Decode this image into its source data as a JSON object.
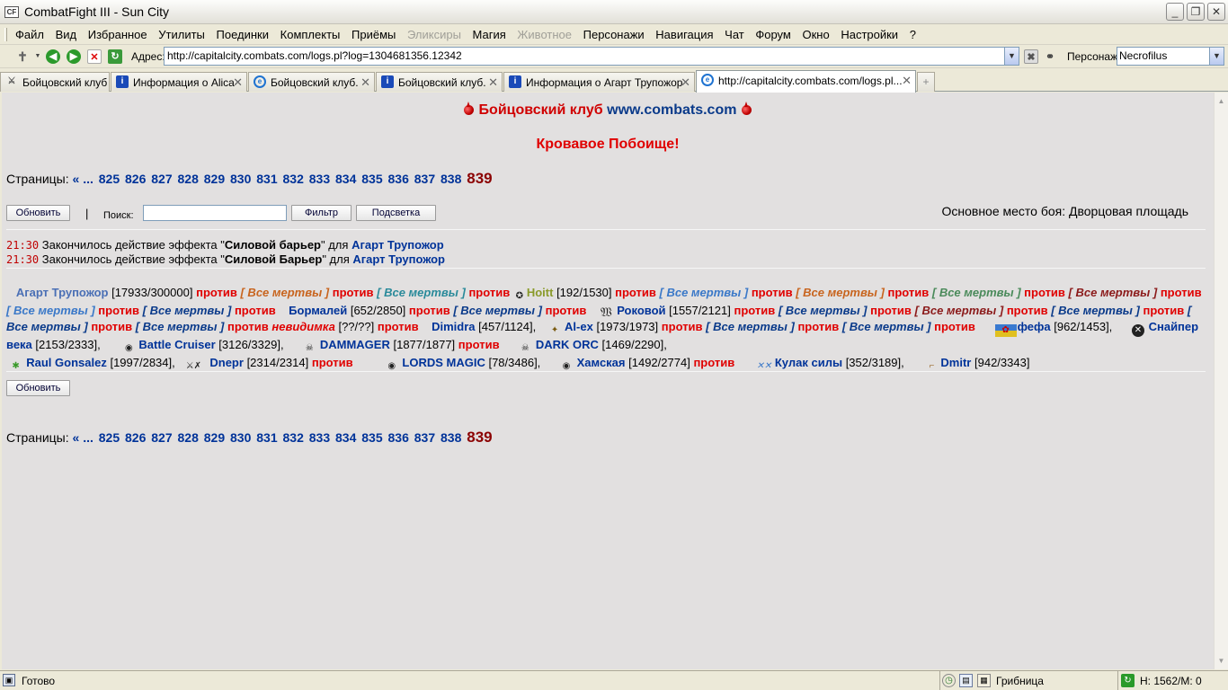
{
  "window": {
    "title": "CombatFight III - Sun City",
    "icon_text": "CF"
  },
  "menu": [
    "Файл",
    "Вид",
    "Избранное",
    "Утилиты",
    "Поединки",
    "Комплекты",
    "Приёмы",
    "Эликсиры",
    "Магия",
    "Животное",
    "Персонажи",
    "Навигация",
    "Чат",
    "Форум",
    "Окно",
    "Настройки",
    "?"
  ],
  "menu_disabled": [
    "Эликсиры",
    "Животное"
  ],
  "toolbar": {
    "address_label": "Адрес:",
    "address": "http://capitalcity.combats.com/logs.pl?log=1304681356.12342",
    "persona_label": "Персонаж:",
    "persona": "Necrofilus"
  },
  "tabs": [
    {
      "label": "Бойцовский клуб",
      "icon": "crossed-swords-icon"
    },
    {
      "label": "Информация о Alica",
      "icon": "info-icon"
    },
    {
      "label": "Бойцовский клуб.",
      "icon": "ie-icon"
    },
    {
      "label": "Бойцовский клуб.",
      "icon": "info-icon"
    },
    {
      "label": "Информация о Агарт Трупожор",
      "icon": "info-icon"
    },
    {
      "label": "http://capitalcity.combats.com/logs.pl...",
      "icon": "ie-icon"
    }
  ],
  "page": {
    "club_title": "Бойцовский клуб",
    "site": "www.combats.com",
    "subtitle": "Кровавое Побоище!",
    "pages_label": "Страницы:",
    "pages_prev": "« ...",
    "pages": [
      "825",
      "826",
      "827",
      "828",
      "829",
      "830",
      "831",
      "832",
      "833",
      "834",
      "835",
      "836",
      "837",
      "838"
    ],
    "current_page": "839",
    "refresh_label": "Обновить",
    "separator": "|",
    "search_label": "Поиск:",
    "search_value": "",
    "filter_label": "Фильтр",
    "highlight_label": "Подсветка",
    "main_place": "Основное место боя: Дворцовая площадь",
    "log": [
      {
        "time": "21:30",
        "text1": "Закончилось действие эффекта \"",
        "effect": "Силовой барьер",
        "text2": "\" для ",
        "who": "Агарт Трупожор"
      },
      {
        "time": "21:30",
        "text1": "Закончилось действие эффекта \"",
        "effect": "Силовой Барьер",
        "text2": "\" для ",
        "who": "Агарт Трупожор"
      }
    ],
    "vs": "против",
    "all_dead": "[ Все мертвы ]",
    "fighters": {
      "agart": {
        "name": "Агарт Трупожор",
        "hp": "[17933/300000]"
      },
      "hoitt": {
        "name": "Hoitt",
        "hp": "[192/1530]"
      },
      "bormalei": {
        "name": "Бормалей",
        "hp": "[652/2850]"
      },
      "rokovoi": {
        "name": "Роковой",
        "hp": "[1557/2121]"
      },
      "dimidra": {
        "name": "Dimidra",
        "hp": "[457/1124],"
      },
      "alex": {
        "name": "Al-ex",
        "hp": "[1973/1973]"
      },
      "invisible": {
        "name": "невидимка",
        "hp": "[??/??]"
      },
      "fefa": {
        "name": "фефа",
        "hp": "[962/1453],"
      },
      "sniper": {
        "name": "Снайпер века",
        "hp": "[2153/2333],"
      },
      "cruiser": {
        "name": "Battle Cruiser",
        "hp": "[3126/3329],"
      },
      "dammager": {
        "name": "DAMMAGER",
        "hp": "[1877/1877]"
      },
      "darkorc": {
        "name": "DARK ORC",
        "hp": "[1469/2290],"
      },
      "raul": {
        "name": "Raul Gonsalez",
        "hp": "[1997/2834],"
      },
      "dnepr": {
        "name": "Dnepr",
        "hp": "[2314/2314]"
      },
      "lords": {
        "name": "LORDS MAGIC",
        "hp": "[78/3486],"
      },
      "hamskaya": {
        "name": "Хамская",
        "hp": "[1492/2774]"
      },
      "kulak": {
        "name": "Кулак силы",
        "hp": "[352/3189],"
      },
      "dmitr": {
        "name": "Dmitr",
        "hp": "[942/3343]"
      }
    }
  },
  "status": {
    "ready": "Готово",
    "zone": "Грибница",
    "coords": "H: 1562/M: 0"
  }
}
